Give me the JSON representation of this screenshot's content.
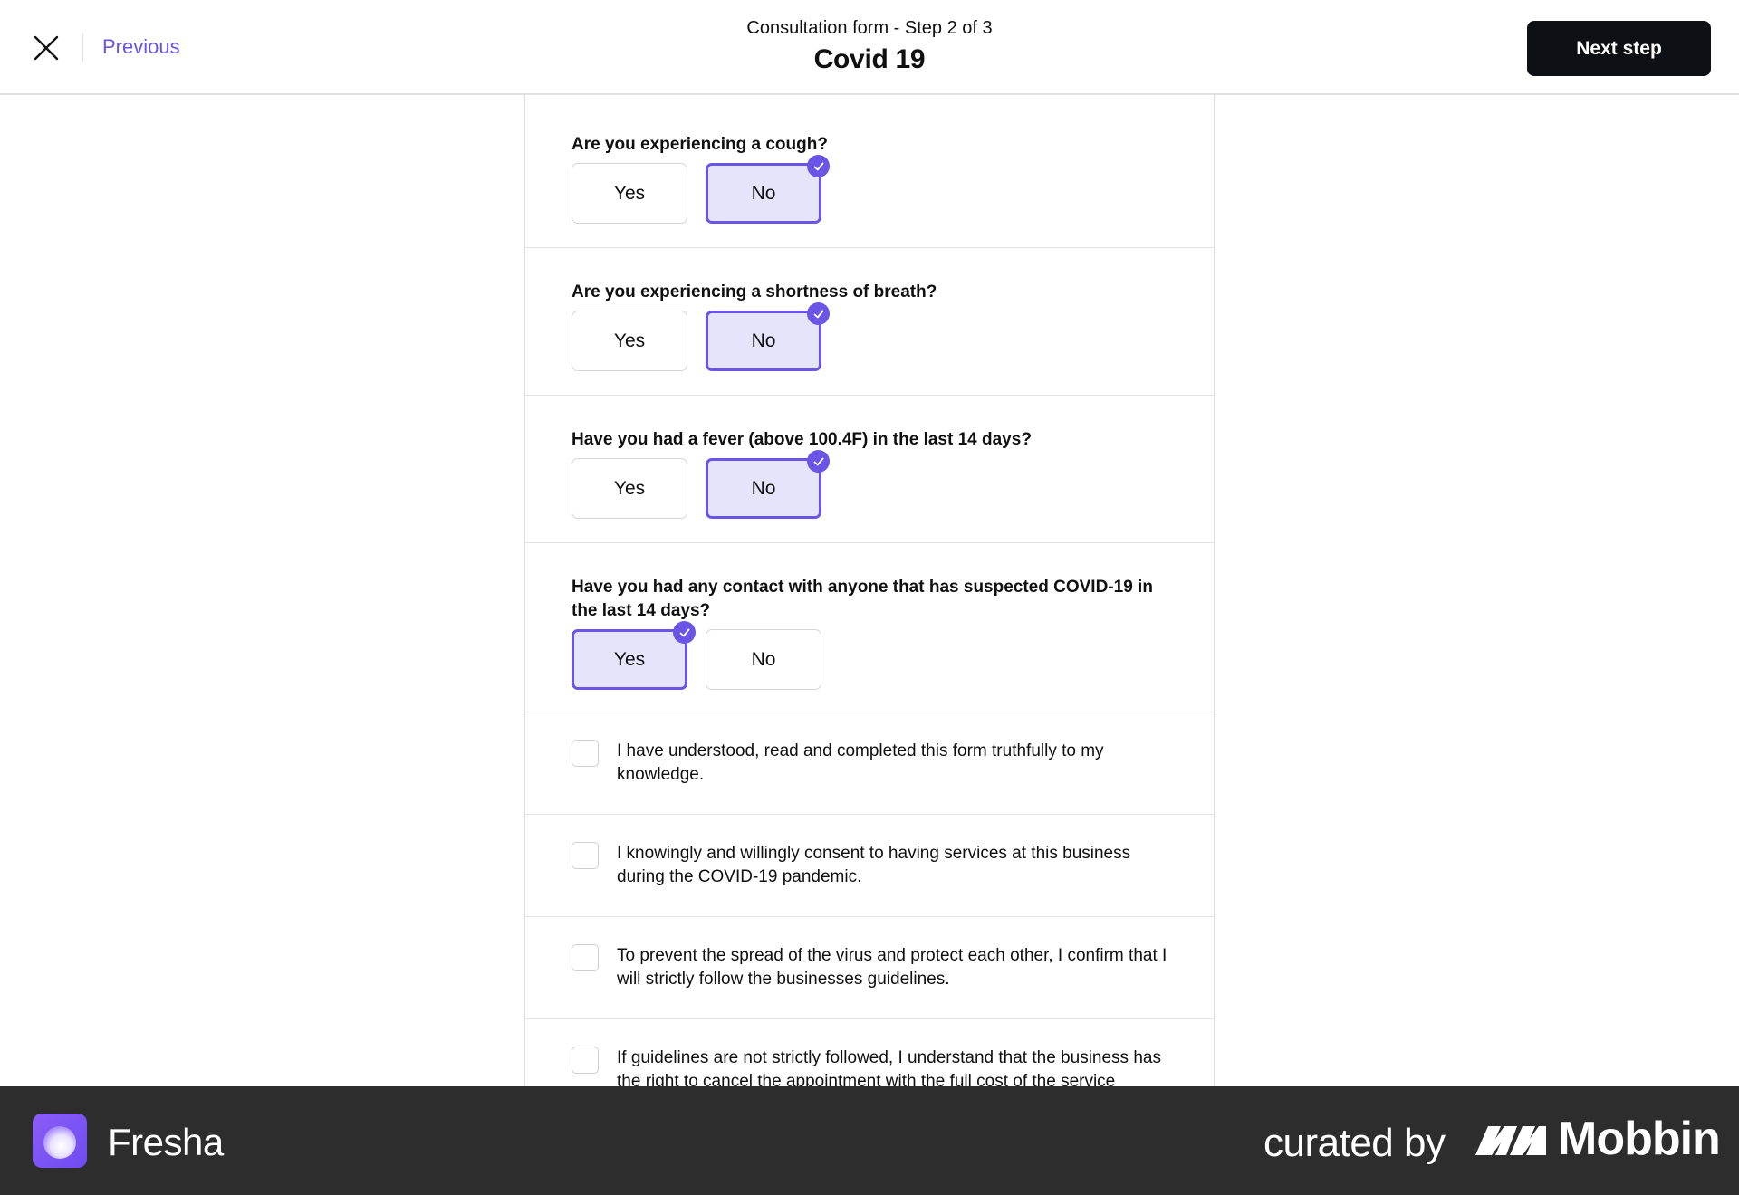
{
  "header": {
    "close_icon": "close-icon",
    "previous_label": "Previous",
    "step_label": "Consultation form - Step 2 of 3",
    "title": "Covid 19",
    "next_label": "Next step"
  },
  "questions": [
    {
      "text": "Are you experiencing a cough?",
      "options": [
        "Yes",
        "No"
      ],
      "selected": "No"
    },
    {
      "text": "Are you experiencing a shortness of breath?",
      "options": [
        "Yes",
        "No"
      ],
      "selected": "No"
    },
    {
      "text": "Have you had a fever (above 100.4F) in the last 14 days?",
      "options": [
        "Yes",
        "No"
      ],
      "selected": "No"
    },
    {
      "text": "Have you had any contact with anyone that has suspected COVID-19 in the last 14 days?",
      "options": [
        "Yes",
        "No"
      ],
      "selected": "Yes"
    }
  ],
  "agreements": [
    {
      "text": "I have understood, read and completed this form truthfully to my knowledge.",
      "checked": false
    },
    {
      "text": "I knowingly and willingly consent to having services at this business during the COVID-19 pandemic.",
      "checked": false
    },
    {
      "text": "To prevent the spread of the virus and protect each other, I confirm that I will strictly follow the businesses guidelines.",
      "checked": false
    },
    {
      "text": "If guidelines are not strictly followed, I understand that the business has the right to cancel the appointment with the full cost of the service",
      "checked": false
    }
  ],
  "footer": {
    "brand_name": "Fresha",
    "curated_label": "curated by",
    "curator_name": "Mobbin"
  },
  "colors": {
    "accent": "#6a55e6",
    "selected_bg": "#e5e4fb",
    "primary_button": "#0d1116",
    "footer_bg": "#2d2d2e"
  }
}
